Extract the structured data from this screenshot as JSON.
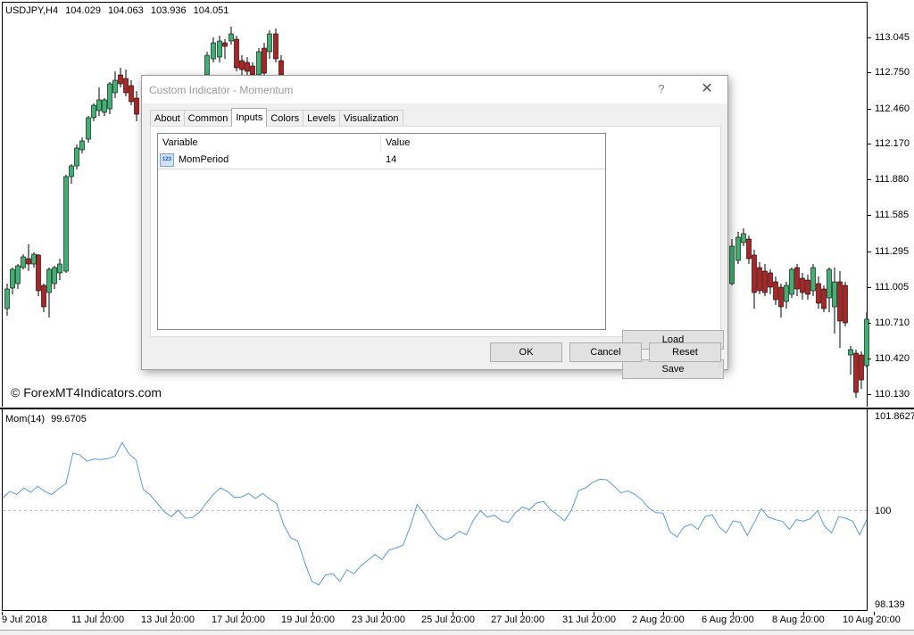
{
  "chart": {
    "symbol": "USDJPY,H4",
    "open": "104.029",
    "high": "104.063",
    "low": "103.936",
    "close": "104.051",
    "watermark": "© ForexMT4Indicators.com",
    "colors": {
      "bull": "#3cb371",
      "bear": "#b22222",
      "momentum_line": "#5b9bd5",
      "grid_dash": "#c0c0c0"
    },
    "price_axis": [
      "113.045",
      "112.750",
      "112.460",
      "112.170",
      "111.880",
      "111.585",
      "111.295",
      "111.005",
      "110.710",
      "110.420",
      "110.130"
    ],
    "time_axis": [
      "9 Jul 2018",
      "11 Jul 20:00",
      "13 Jul 20:00",
      "17 Jul 20:00",
      "19 Jul 20:00",
      "23 Jul 20:00",
      "25 Jul 20:00",
      "27 Jul 20:00",
      "31 Jul 20:00",
      "2 Aug 20:00",
      "6 Aug 20:00",
      "8 Aug 20:00",
      "10 Aug 20:00"
    ]
  },
  "momentum": {
    "name": "Mom(14)",
    "value": "99.6705",
    "axis": [
      "101.8627",
      "100",
      "98.139"
    ],
    "line": [
      100.25,
      100.38,
      100.32,
      100.45,
      100.36,
      100.48,
      100.38,
      100.32,
      100.44,
      100.53,
      101.14,
      101.1,
      100.98,
      101.02,
      101.01,
      101.03,
      101.08,
      101.35,
      101.12,
      101.0,
      100.42,
      100.31,
      100.15,
      99.98,
      99.88,
      100.01,
      99.85,
      99.86,
      99.97,
      100.15,
      100.32,
      100.45,
      100.38,
      100.26,
      100.27,
      100.34,
      100.24,
      100.34,
      100.23,
      100.14,
      99.72,
      99.46,
      99.4,
      98.98,
      98.6,
      98.53,
      98.73,
      98.75,
      98.6,
      98.83,
      98.75,
      98.91,
      99.02,
      99.13,
      99.03,
      99.22,
      99.26,
      99.32,
      99.68,
      100.12,
      99.94,
      99.71,
      99.52,
      99.42,
      99.48,
      99.59,
      99.52,
      99.81,
      100.0,
      99.87,
      99.91,
      99.8,
      99.77,
      99.96,
      100.07,
      100.02,
      100.15,
      100.18,
      100.02,
      99.91,
      99.8,
      100.02,
      100.4,
      100.45,
      100.56,
      100.62,
      100.61,
      100.49,
      100.35,
      100.39,
      100.32,
      100.21,
      100.05,
      99.96,
      99.95,
      99.58,
      99.48,
      99.68,
      99.73,
      99.63,
      99.88,
      99.92,
      99.68,
      99.56,
      99.8,
      99.77,
      99.51,
      99.77,
      100.04,
      99.87,
      99.82,
      99.79,
      99.63,
      99.82,
      99.79,
      99.84,
      100.0,
      99.69,
      99.56,
      99.88,
      99.85,
      99.79,
      99.52,
      99.82
    ]
  },
  "dialog": {
    "title": "Custom Indicator - Momentum",
    "help_icon": "?",
    "close_icon": "✕",
    "tabs": [
      "About",
      "Common",
      "Inputs",
      "Colors",
      "Levels",
      "Visualization"
    ],
    "active_tab": "Inputs",
    "table": {
      "col_variable": "Variable",
      "col_value": "Value",
      "row_icon": "123",
      "row_variable": "MomPeriod",
      "row_value": "14"
    },
    "buttons": {
      "load": "Load",
      "save": "Save",
      "ok": "OK",
      "cancel": "Cancel",
      "reset": "Reset"
    }
  }
}
